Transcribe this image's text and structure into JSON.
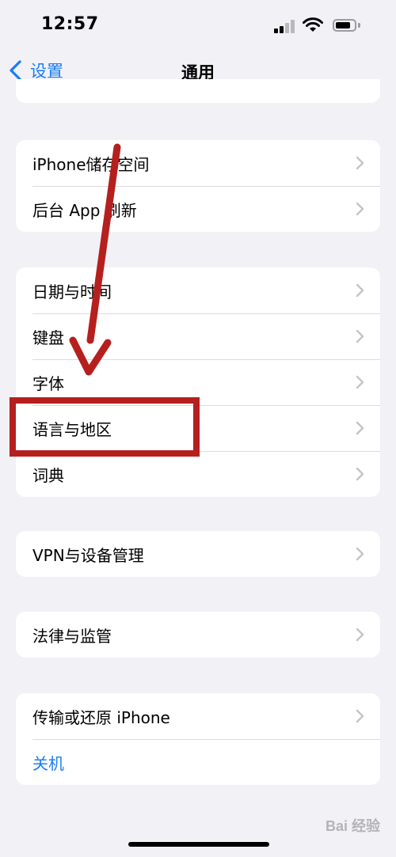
{
  "status_bar": {
    "time": "12:57"
  },
  "nav": {
    "back_label": "设置",
    "title": "通用"
  },
  "groups": [
    {
      "items": [
        {
          "label": "iPhone储存空间"
        },
        {
          "label": "后台 App 刷新"
        }
      ]
    },
    {
      "items": [
        {
          "label": "日期与时间"
        },
        {
          "label": "键盘"
        },
        {
          "label": "字体"
        },
        {
          "label": "语言与地区"
        },
        {
          "label": "词典"
        }
      ]
    },
    {
      "items": [
        {
          "label": "VPN与设备管理"
        }
      ]
    },
    {
      "items": [
        {
          "label": "法律与监管"
        }
      ]
    },
    {
      "items": [
        {
          "label": "传输或还原 iPhone"
        },
        {
          "label": "关机"
        }
      ]
    }
  ],
  "watermark": "Bai 经验",
  "colors": {
    "accent": "#1b7cf5",
    "annotation": "#b5201f",
    "background": "#f1f1f6"
  },
  "icons": {
    "back": "chevron-left-icon",
    "disclosure": "chevron-right-icon",
    "wifi": "wifi-icon",
    "signal": "cellular-signal-icon",
    "battery": "battery-icon"
  }
}
